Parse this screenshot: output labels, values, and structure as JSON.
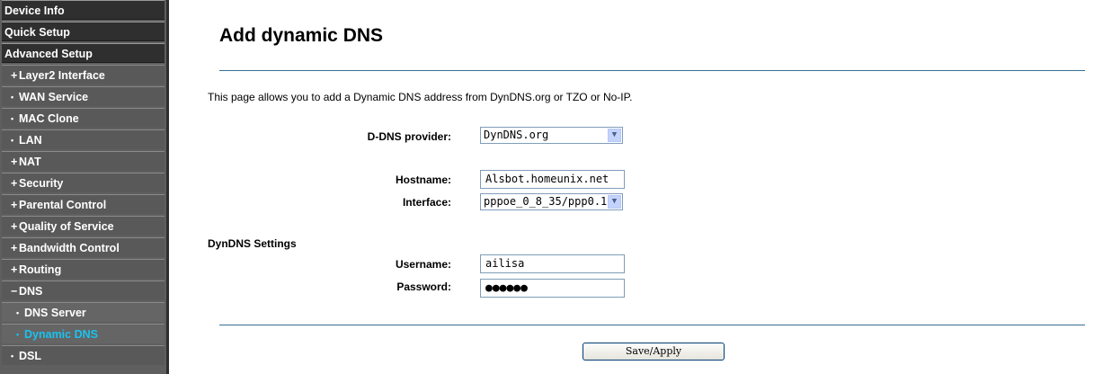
{
  "sidebar": {
    "items": [
      {
        "label": "Device Info",
        "marker": "",
        "level": "top",
        "active": false
      },
      {
        "label": "Quick Setup",
        "marker": "",
        "level": "top",
        "active": false
      },
      {
        "label": "Advanced Setup",
        "marker": "",
        "level": "top",
        "active": false
      },
      {
        "label": "Layer2 Interface",
        "marker": "+",
        "level": "sub",
        "active": false
      },
      {
        "label": "WAN Service",
        "marker": "•",
        "level": "sub",
        "active": false
      },
      {
        "label": "MAC Clone",
        "marker": "•",
        "level": "sub",
        "active": false
      },
      {
        "label": "LAN",
        "marker": "•",
        "level": "sub",
        "active": false
      },
      {
        "label": "NAT",
        "marker": "+",
        "level": "sub",
        "active": false
      },
      {
        "label": "Security",
        "marker": "+",
        "level": "sub",
        "active": false
      },
      {
        "label": "Parental Control",
        "marker": "+",
        "level": "sub",
        "active": false
      },
      {
        "label": "Quality of Service",
        "marker": "+",
        "level": "sub",
        "active": false
      },
      {
        "label": "Bandwidth Control",
        "marker": "+",
        "level": "sub",
        "active": false
      },
      {
        "label": "Routing",
        "marker": "+",
        "level": "sub",
        "active": false
      },
      {
        "label": "DNS",
        "marker": "−",
        "level": "sub",
        "active": false
      },
      {
        "label": "DNS Server",
        "marker": "•",
        "level": "sub2",
        "active": false
      },
      {
        "label": "Dynamic DNS",
        "marker": "•",
        "level": "sub2",
        "active": true
      },
      {
        "label": "DSL",
        "marker": "•",
        "level": "sub",
        "active": false
      }
    ]
  },
  "main": {
    "title": "Add dynamic DNS",
    "description": "This page allows you to add a Dynamic DNS address from DynDNS.org or TZO or No-IP.",
    "provider_label": "D-DNS provider:",
    "provider_value": "DynDNS.org",
    "hostname_label": "Hostname:",
    "hostname_value": "Alsbot.homeunix.net",
    "interface_label": "Interface:",
    "interface_value": "pppoe_0_8_35/ppp0.1",
    "dyndns_section": "DynDNS Settings",
    "username_label": "Username:",
    "username_value": "ailisa",
    "password_label": "Password:",
    "password_value": "●●●●●●",
    "save_label": "Save/Apply"
  },
  "colors": {
    "active_nav": "#18c3f0",
    "rule": "#3a6e93"
  }
}
